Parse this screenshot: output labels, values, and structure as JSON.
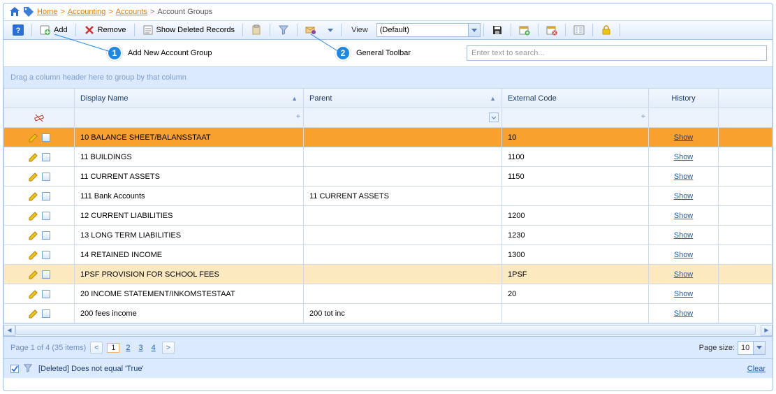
{
  "breadcrumb": {
    "home": "Home",
    "accounting": "Accounting",
    "accounts": "Accounts",
    "current": "Account Groups"
  },
  "toolbar": {
    "add": "Add",
    "remove": "Remove",
    "showdel": "Show Deleted Records",
    "view": "View",
    "view_value": "(Default)"
  },
  "search": {
    "placeholder": "Enter text to search..."
  },
  "callouts": {
    "c1": "1",
    "c1_text": "Add New Account Group",
    "c2": "2",
    "c2_text": "General Toolbar"
  },
  "group_panel": "Drag a column header here to group by that column",
  "cols": {
    "name": "Display Name",
    "parent": "Parent",
    "code": "External Code",
    "history": "History"
  },
  "rows": [
    {
      "name": "10 BALANCE SHEET/BALANSSTAAT",
      "parent": "",
      "code": "10",
      "hist": "Show"
    },
    {
      "name": "11 BUILDINGS",
      "parent": "",
      "code": "1100",
      "hist": "Show"
    },
    {
      "name": "11 CURRENT ASSETS",
      "parent": "",
      "code": "1150",
      "hist": "Show"
    },
    {
      "name": "111 Bank Accounts",
      "parent": "11 CURRENT ASSETS",
      "code": "",
      "hist": "Show"
    },
    {
      "name": "12 CURRENT LIABILITIES",
      "parent": "",
      "code": "1200",
      "hist": "Show"
    },
    {
      "name": "13 LONG TERM LIABILITIES",
      "parent": "",
      "code": "1230",
      "hist": "Show"
    },
    {
      "name": "14 RETAINED INCOME",
      "parent": "",
      "code": "1300",
      "hist": "Show"
    },
    {
      "name": "1PSF PROVISION FOR SCHOOL FEES",
      "parent": "",
      "code": "1PSF",
      "hist": "Show"
    },
    {
      "name": "20 INCOME STATEMENT/INKOMSTESTAAT",
      "parent": "",
      "code": "20",
      "hist": "Show"
    },
    {
      "name": "200 fees income",
      "parent": "200 tot inc",
      "code": "",
      "hist": "Show"
    }
  ],
  "pager": {
    "summary": "Page 1 of 4 (35 items)",
    "pages": [
      "1",
      "2",
      "3",
      "4"
    ],
    "size_label": "Page size:",
    "size": "10"
  },
  "filter": {
    "expr": "[Deleted] Does not equal 'True'",
    "clear": "Clear"
  }
}
